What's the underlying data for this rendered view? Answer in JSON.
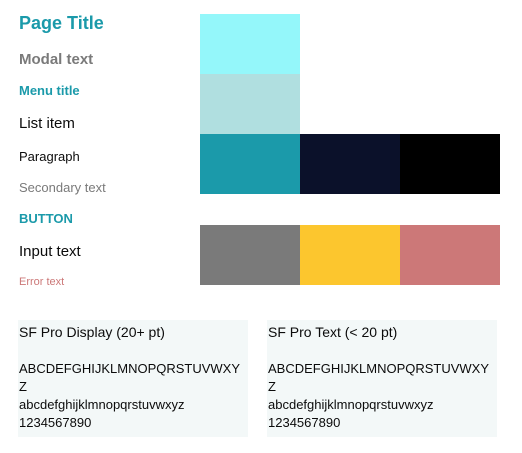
{
  "typography": {
    "page_title": "Page Title",
    "modal_text": "Modal text",
    "menu_title": "Menu title",
    "list_item": "List item",
    "paragraph": "Paragraph",
    "secondary_text": "Secondary text",
    "button": "BUTTON",
    "input_text": "Input text",
    "error_text": "Error text"
  },
  "swatches": [
    {
      "color": "#94f7fa"
    },
    {
      "color": "#b0dfe0"
    },
    {
      "color": "#1b9aaa"
    },
    {
      "color": "#0b112a"
    },
    {
      "color": "#000000"
    },
    {
      "color": "#7a7a7a"
    },
    {
      "color": "#fcc62e"
    },
    {
      "color": "#cc7878"
    }
  ],
  "font_cards": [
    {
      "title": "SF Pro Display (20+ pt)",
      "uppercase": "ABCDEFGHIJKLMNOPQRSTUVWXYZ",
      "lowercase": "abcdefghijklmnopqrstuvwxyz",
      "digits": "1234567890"
    },
    {
      "title": "SF Pro Text (< 20 pt)",
      "uppercase": "ABCDEFGHIJKLMNOPQRSTUVWXYZ",
      "lowercase": "abcdefghijklmnopqrstuvwxyz",
      "digits": "1234567890"
    }
  ]
}
